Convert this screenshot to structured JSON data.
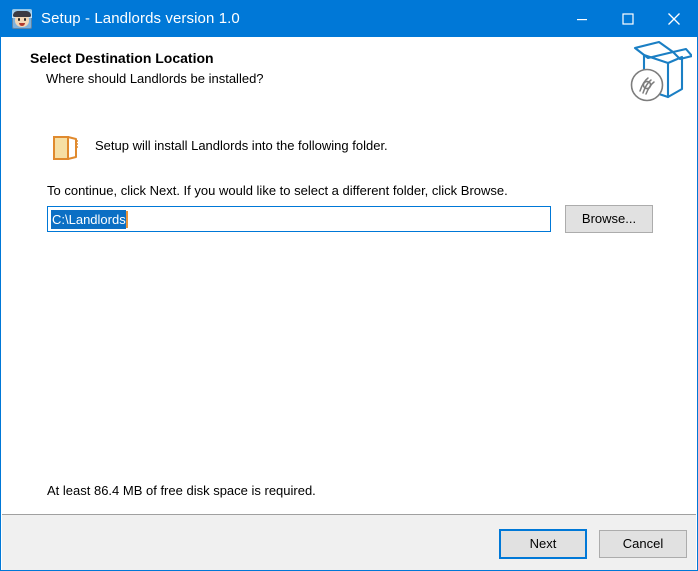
{
  "window": {
    "title": "Setup - Landlords version 1.0",
    "app_icon": "landlords-app-icon",
    "accent_color": "#0078d7",
    "controls": {
      "minimize": "minimize-icon",
      "maximize": "maximize-icon",
      "close": "close-icon"
    }
  },
  "header": {
    "title": "Select Destination Location",
    "subtitle": "Where should Landlords be installed?",
    "artwork": "setup-box-disc-icon"
  },
  "main": {
    "folder_icon": "folder-icon",
    "install_message": "Setup will install Landlords into the following folder.",
    "continue_message": "To continue, click Next. If you would like to select a different folder, click Browse.",
    "path_field": {
      "value": "C:\\Landlords",
      "placeholder": "C:\\Landlords",
      "selected": true,
      "selection_color": "#0b6fc4",
      "caret_color": "#e8933a"
    },
    "browse_label": "Browse...",
    "disk_space_message": "At least 86.4 MB of free disk space is required."
  },
  "footer": {
    "next_label": "Next",
    "cancel_label": "Cancel"
  }
}
